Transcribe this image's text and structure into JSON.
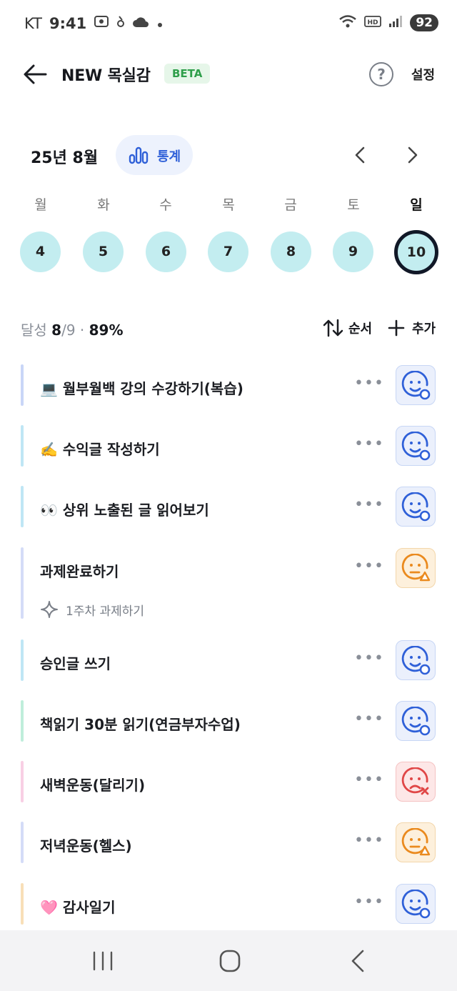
{
  "status_bar": {
    "carrier": "KT",
    "time": "9:41",
    "battery": "92"
  },
  "app_bar": {
    "title": "NEW 목실감",
    "badge": "BETA",
    "help": "?",
    "settings": "설정"
  },
  "calendar": {
    "month": "25년 8월",
    "stats_label": "통계",
    "weekdays": [
      "월",
      "화",
      "수",
      "목",
      "금",
      "토",
      "일"
    ],
    "days": [
      "4",
      "5",
      "6",
      "7",
      "8",
      "9",
      "10"
    ],
    "selected_index": 6
  },
  "summary": {
    "prefix": "달성",
    "done": "8",
    "total": "/9",
    "sep": " · ",
    "percent": "89%",
    "order": "순서",
    "add": "추가"
  },
  "tasks": [
    {
      "label": "💻 월부월백 강의 수강하기(복습)",
      "bar_color": "#c9d6f7",
      "mood": "blue",
      "mood_icon": "smile-check-icon"
    },
    {
      "label": "✍️ 수익글 작성하기",
      "bar_color": "#bfe6f5",
      "mood": "blue",
      "mood_icon": "smile-check-icon"
    },
    {
      "label": "👀 상위 노출된 글 읽어보기",
      "bar_color": "#bfe6f5",
      "mood": "blue",
      "mood_icon": "smile-check-icon"
    },
    {
      "label": "과제완료하기",
      "sub": "1주차 과제하기",
      "bar_color": "#d4dcf7",
      "mood": "orange",
      "mood_icon": "neutral-warning-icon"
    },
    {
      "label": "승인글 쓰기",
      "bar_color": "#bfe6f5",
      "mood": "blue",
      "mood_icon": "smile-check-icon"
    },
    {
      "label": "책읽기 30분 읽기(연금부자수업)",
      "bar_color": "#bfeedb",
      "mood": "blue",
      "mood_icon": "smile-check-icon"
    },
    {
      "label": "새벽운동(달리기)",
      "bar_color": "#f8cfe4",
      "mood": "red",
      "mood_icon": "sad-x-icon"
    },
    {
      "label": "저녁운동(헬스)",
      "bar_color": "#d4dcf7",
      "mood": "orange",
      "mood_icon": "neutral-warning-icon"
    },
    {
      "label": "🩷 감사일기",
      "bar_color": "#f8dfb8",
      "mood": "blue",
      "mood_icon": "smile-check-icon"
    }
  ],
  "colors": {
    "accent": "#2f60d8",
    "day_circle": "#c3edf0",
    "orange": "#ea8a1e",
    "red": "#e04747"
  }
}
